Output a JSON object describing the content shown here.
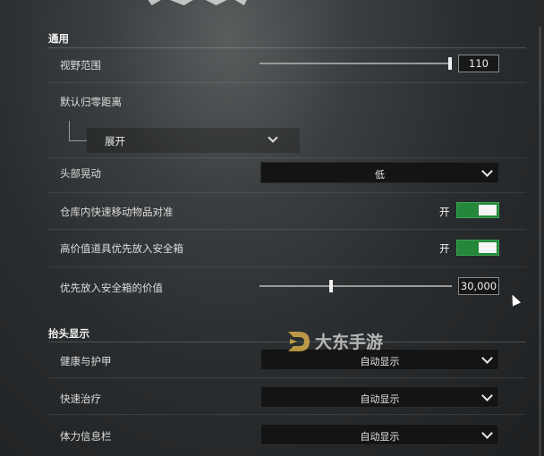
{
  "sections": {
    "general": {
      "title": "通用"
    },
    "hud": {
      "title": "抬头显示"
    }
  },
  "general": {
    "fov": {
      "label": "视野范围",
      "value": "110",
      "level": 1.0
    },
    "zeroing": {
      "label": "默认归零距离",
      "expand_label": "展开"
    },
    "head_bob": {
      "label": "头部晃动",
      "value": "低"
    },
    "warehouse_move": {
      "label": "仓库内快速移动物品对准",
      "state": "开",
      "on": true
    },
    "high_value_safe": {
      "label": "高价值道具优先放入安全箱",
      "state": "开",
      "on": true
    },
    "safe_priority_value": {
      "label": "优先放入安全箱的价值",
      "value": "30,000",
      "level": 0.37
    }
  },
  "hud": {
    "health_armor": {
      "label": "健康与护甲",
      "value": "自动显示"
    },
    "quick_heal": {
      "label": "快速治疗",
      "value": "自动显示"
    },
    "stamina_bar": {
      "label": "体力信息栏",
      "value": "自动显示"
    }
  },
  "watermark": {
    "text": "大东手游"
  },
  "colors": {
    "toggle_on": "#24873a",
    "dropdown_bg": "#141414"
  }
}
